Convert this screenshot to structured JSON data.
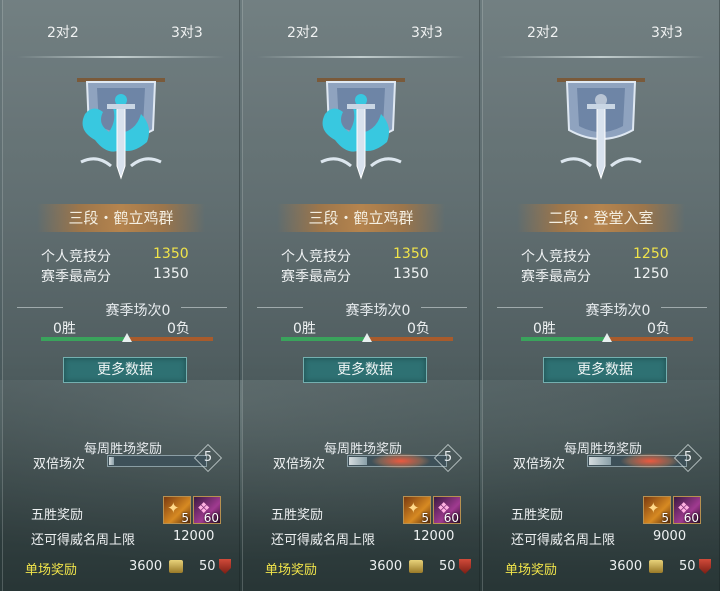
{
  "panels": [
    {
      "tabs": [
        "2对2",
        "3对3"
      ],
      "rank_title": "三段・鹤立鸡群",
      "personal_score_label": "个人竞技分",
      "personal_score": "1350",
      "season_high_label": "赛季最高分",
      "season_high": "1350",
      "season_matches": "赛季场次0",
      "wins": "0胜",
      "losses": "0负",
      "win_ratio": 0.5,
      "more_data": "更多数据",
      "weekly_reward_title": "每周胜场奖励",
      "double_label": "双倍场次",
      "double_progress": 0.15,
      "double_count": "5",
      "double_glow": false,
      "five_wins_label": "五胜奖励",
      "item1_icon": "award-item-icon",
      "item1_count": "5",
      "item2_icon": "award-item-icon",
      "item2_count": "60",
      "limit_label": "还可得威名周上限",
      "limit_value": "12000",
      "single_reward_label": "单场奖励",
      "gold_value": "3600",
      "honor_value": "50"
    },
    {
      "tabs": [
        "2对2",
        "3对3"
      ],
      "rank_title": "三段・鹤立鸡群",
      "personal_score_label": "个人竞技分",
      "personal_score": "1350",
      "season_high_label": "赛季最高分",
      "season_high": "1350",
      "season_matches": "赛季场次0",
      "wins": "0胜",
      "losses": "0负",
      "win_ratio": 0.5,
      "more_data": "更多数据",
      "weekly_reward_title": "每周胜场奖励",
      "double_label": "双倍场次",
      "double_progress": 0.55,
      "double_count": "5",
      "double_glow": true,
      "five_wins_label": "五胜奖励",
      "item1_icon": "award-item-icon",
      "item1_count": "5",
      "item2_icon": "award-item-icon",
      "item2_count": "60",
      "limit_label": "还可得威名周上限",
      "limit_value": "12000",
      "single_reward_label": "单场奖励",
      "gold_value": "3600",
      "honor_value": "50"
    },
    {
      "tabs": [
        "2对2",
        "3对3"
      ],
      "rank_title": "二段・登堂入室",
      "personal_score_label": "个人竞技分",
      "personal_score": "1250",
      "season_high_label": "赛季最高分",
      "season_high": "1250",
      "season_matches": "赛季场次0",
      "wins": "0胜",
      "losses": "0负",
      "win_ratio": 0.5,
      "more_data": "更多数据",
      "weekly_reward_title": "每周胜场奖励",
      "double_label": "双倍场次",
      "double_progress": 0.65,
      "double_count": "5",
      "double_glow": true,
      "five_wins_label": "五胜奖励",
      "item1_icon": "award-item-icon",
      "item1_count": "5",
      "item2_icon": "award-item-icon",
      "item2_count": "60",
      "limit_label": "还可得威名周上限",
      "limit_value": "9000",
      "single_reward_label": "单场奖励",
      "gold_value": "3600",
      "honor_value": "50"
    }
  ],
  "colors": {
    "score_highlight": "#f1e44a",
    "rank_banner": "#c48848",
    "button": "#2e7173",
    "win_bar": "#3aa35c",
    "loss_bar": "#a85b2c",
    "emblem_glow_rank3": "#38c8e0",
    "emblem_rank2": "#b8c4d4"
  }
}
